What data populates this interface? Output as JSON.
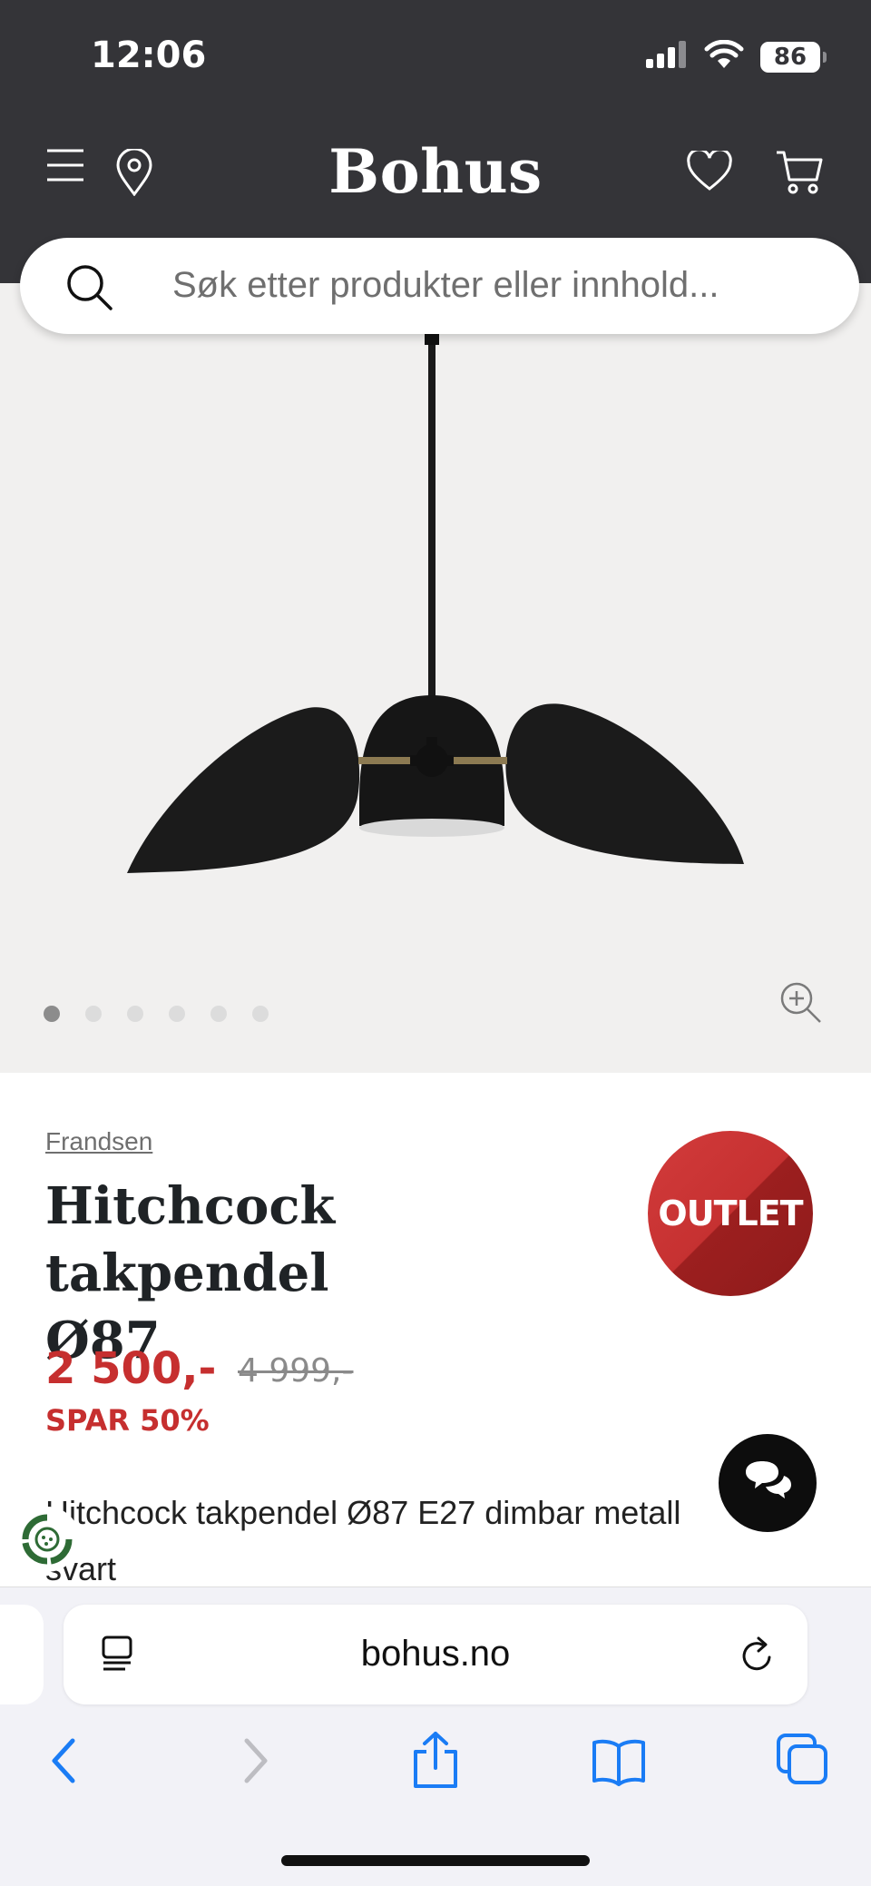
{
  "status": {
    "time": "12:06",
    "battery": "86",
    "icons": [
      "signal-icon",
      "wifi-icon",
      "battery-icon"
    ]
  },
  "header": {
    "brand": "Bohus",
    "icons": [
      "menu-icon",
      "location-pin-icon",
      "heart-icon",
      "cart-icon"
    ]
  },
  "search": {
    "placeholder": "Søk etter produkter eller innhold..."
  },
  "gallery": {
    "image": "product-image-black-pendant-lamp",
    "dots_total": 6,
    "active_dot": 1
  },
  "product": {
    "brand": "Frandsen",
    "title_line1": "Hitchcock takpendel",
    "title_line2": "Ø87",
    "badge": "OUTLET",
    "price": "2 500,-",
    "old_price": "4 999,-",
    "savings": "SPAR 50%",
    "description_line1": "Hitchcock takpendel Ø87 E27 dimbar metall",
    "description_line2": "svart"
  },
  "browser": {
    "url": "bohus.no",
    "icons": [
      "tab-overview-icon",
      "reload-icon",
      "back-icon",
      "forward-icon",
      "share-icon",
      "bookmarks-icon",
      "tabs-icon"
    ]
  },
  "colors": {
    "header_bg": "#343438",
    "sale_red": "#c62f2f",
    "safari_blue": "#1a7cf5",
    "gallery_bg": "#f1f0ef"
  }
}
